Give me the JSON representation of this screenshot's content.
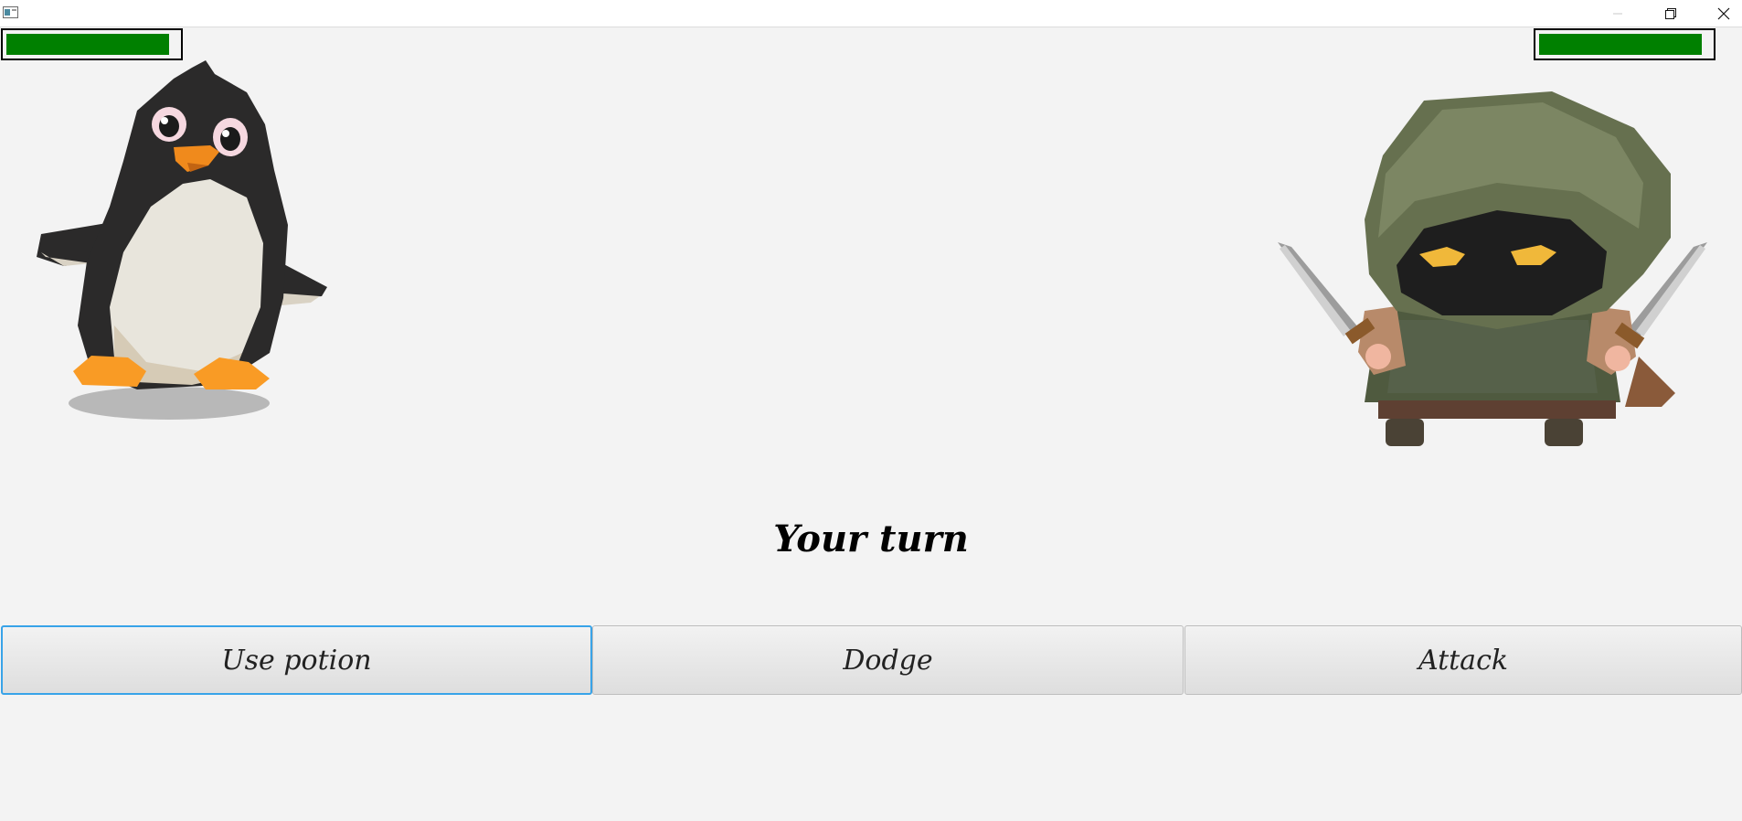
{
  "window": {
    "controls": [
      "minimize-icon",
      "restore-icon",
      "close-icon"
    ]
  },
  "player": {
    "sprite": "penguin",
    "health_fraction": 0.95,
    "health_color": "#008000"
  },
  "enemy": {
    "sprite": "hooded-ninja-with-daggers",
    "health_fraction": 0.95,
    "health_color": "#008000"
  },
  "status": {
    "turn_text": "Your turn"
  },
  "actions": {
    "potion_label": "Use potion",
    "dodge_label": "Dodge",
    "attack_label": "Attack"
  },
  "colors": {
    "focus_border": "#38a3e8",
    "background": "#f3f3f3"
  }
}
